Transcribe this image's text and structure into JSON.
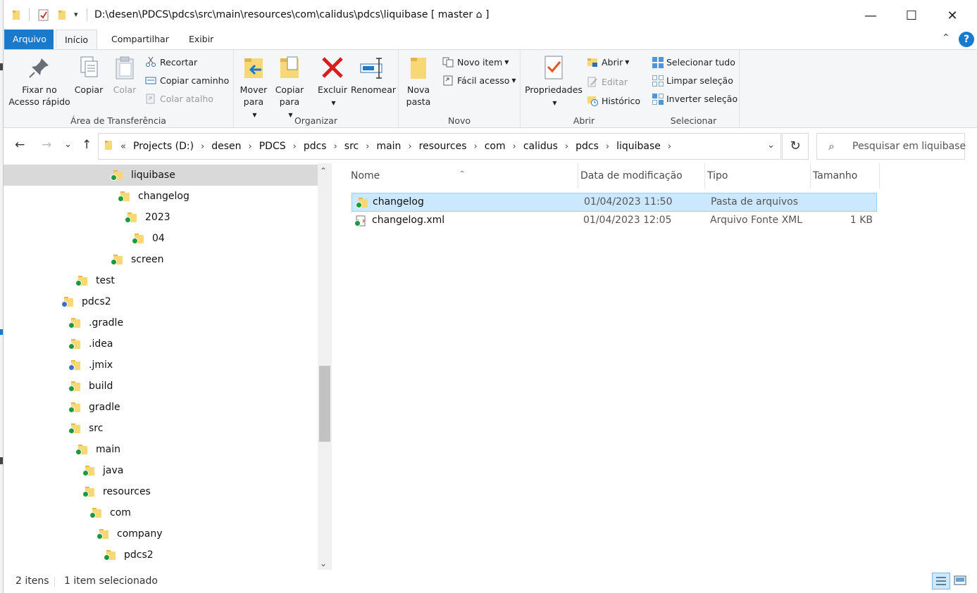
{
  "window": {
    "title": "D:\\desen\\PDCS\\pdcs\\src\\main\\resources\\com\\calidus\\pdcs\\liquibase [ master ⌂ ]",
    "controls": {
      "minimize": "—",
      "maximize": "☐",
      "close": "✕"
    }
  },
  "tabs": [
    {
      "label": "Arquivo"
    },
    {
      "label": "Início"
    },
    {
      "label": "Compartilhar"
    },
    {
      "label": "Exibir"
    }
  ],
  "help_label": "?",
  "ribbon": {
    "clipboard": {
      "label": "Área de Transferência",
      "pin": "Fixar no Acesso rápido",
      "copy": "Copiar",
      "paste": "Colar",
      "cut": "Recortar",
      "copy_path": "Copiar caminho",
      "paste_shortcut": "Colar atalho"
    },
    "organize": {
      "label": "Organizar",
      "move_to": "Mover para",
      "copy_to": "Copiar para",
      "delete": "Excluir",
      "rename": "Renomear"
    },
    "new": {
      "label": "Novo",
      "new_folder": "Nova pasta",
      "new_item": "Novo item",
      "easy_access": "Fácil acesso"
    },
    "open": {
      "label": "Abrir",
      "properties": "Propriedades",
      "open": "Abrir",
      "edit": "Editar",
      "history": "Histórico"
    },
    "select": {
      "label": "Selecionar",
      "select_all": "Selecionar tudo",
      "select_none": "Limpar seleção",
      "invert": "Inverter seleção"
    }
  },
  "address": {
    "prefix": "«",
    "crumbs": [
      "Projects (D:)",
      "desen",
      "PDCS",
      "pdcs",
      "src",
      "main",
      "resources",
      "com",
      "calidus",
      "pdcs",
      "liquibase"
    ],
    "search_placeholder": "Pesquisar em liquibase"
  },
  "nav_tree": [
    {
      "label": "liquibase",
      "selected": true,
      "badge": "green"
    },
    {
      "label": "changelog",
      "badge": "green"
    },
    {
      "label": "2023",
      "badge": "green"
    },
    {
      "label": "04",
      "badge": "green"
    },
    {
      "label": "screen",
      "badge": "green"
    },
    {
      "label": "test",
      "badge": "green"
    },
    {
      "label": "pdcs2",
      "badge": "blue"
    },
    {
      "label": ".gradle",
      "badge": "green"
    },
    {
      "label": ".idea",
      "badge": "green"
    },
    {
      "label": ".jmix",
      "badge": "blue"
    },
    {
      "label": "build",
      "badge": "green"
    },
    {
      "label": "gradle",
      "badge": "green"
    },
    {
      "label": "src",
      "badge": "green"
    },
    {
      "label": "main",
      "badge": "green"
    },
    {
      "label": "java",
      "badge": "green"
    },
    {
      "label": "resources",
      "badge": "green"
    },
    {
      "label": "com",
      "badge": "green"
    },
    {
      "label": "company",
      "badge": "green"
    },
    {
      "label": "pdcs2",
      "badge": "green"
    }
  ],
  "file_list": {
    "columns": [
      "Nome",
      "Data de modificação",
      "Tipo",
      "Tamanho"
    ],
    "rows": [
      {
        "name": "changelog",
        "modified": "01/04/2023 11:50",
        "type": "Pasta de arquivos",
        "size": "",
        "selected": true,
        "kind": "folder"
      },
      {
        "name": "changelog.xml",
        "modified": "01/04/2023 12:05",
        "type": "Arquivo Fonte XML",
        "size": "1 KB",
        "selected": false,
        "kind": "xml"
      }
    ]
  },
  "status": {
    "count": "2 itens",
    "selection": "1 item selecionado"
  },
  "colors": {
    "accent": "#1979ca",
    "selection": "#cce8ff",
    "badge_green": "#1c9b3a",
    "badge_blue": "#3a6fd1"
  }
}
